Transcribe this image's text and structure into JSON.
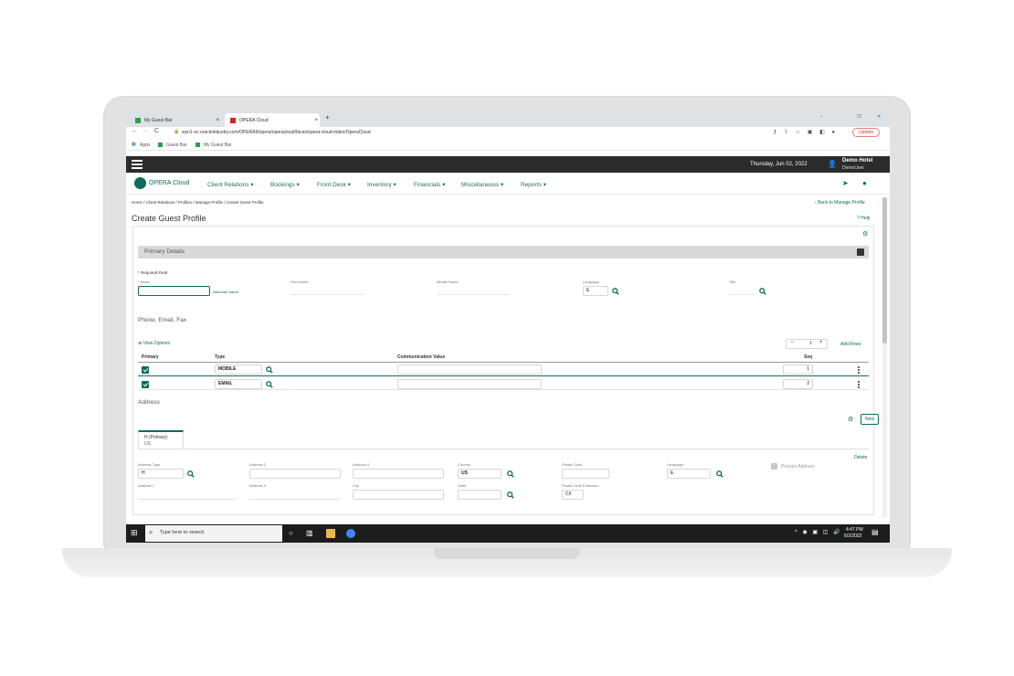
{
  "browser": {
    "tabs": [
      {
        "label": "My Guest Bar"
      },
      {
        "label": "OPERA Cloud"
      }
    ],
    "new_tab": "+",
    "url": "wyn1-oc.oracleindustry.com/OPERA9/opera/operacloud/faces/opera-cloud-index/OperaCloud",
    "bookmarks": [
      "Apps",
      "Guest Bar",
      "My Guest Bar"
    ],
    "update_label": "Update",
    "window_controls": [
      "–",
      "❐",
      "✕"
    ]
  },
  "header": {
    "date": "Thursday, Jun 02, 2022",
    "hotel": "Demo Hotel",
    "user": "DemoUser"
  },
  "nav": {
    "brand": "OPERA Cloud",
    "items": [
      "Client Relations",
      "Bookings",
      "Front Desk",
      "Inventory",
      "Financials",
      "Miscellaneous",
      "Reports"
    ]
  },
  "breadcrumb": "Home / Client Relations / Profiles / Manage Profile / Create Guest Profile",
  "back_link": "Back to Manage Profile",
  "page_title": "Create Guest Profile",
  "help": "Help",
  "primary": {
    "section_title": "Primary Details",
    "required": "* Required Field",
    "name_label": "* Name",
    "alt_name": "Alternate Name",
    "first_name": "First Name",
    "middle_name": "Middle Name",
    "language_label": "Language",
    "language_value": "E",
    "title_label": "Title"
  },
  "comm": {
    "heading": "Phone, Email, Fax",
    "view_options": "View Options",
    "rows_count": "1",
    "add_rows": "Add Rows",
    "cols": [
      "Primary",
      "Type",
      "Communication Value",
      "Seq"
    ],
    "rows": [
      {
        "type": "MOBILE",
        "value": "",
        "seq": "1"
      },
      {
        "type": "EMAIL",
        "value": "",
        "seq": "2"
      }
    ]
  },
  "address": {
    "heading": "Address",
    "new_label": "New",
    "tab_title": "H (Primary)",
    "tab_sub": "US",
    "delete": "Delete",
    "address_type_label": "Address Type",
    "address_type_value": "H",
    "address2": "Address 2",
    "address4": "Address 4",
    "country_label": "Country",
    "country_value": "US",
    "postal_label": "Postal Code",
    "language_label": "Language",
    "language_value": "E",
    "primary_address": "Primary Address",
    "address1": "Address 1",
    "address3": "Address 3",
    "city": "City",
    "state": "State",
    "postal_ext_label": "Postal Code Extension",
    "postal_ext_value": "C/I"
  },
  "taskbar": {
    "search_placeholder": "Type here to search",
    "time": "4:47 PM",
    "date": "6/2/2022"
  },
  "colors": {
    "accent": "#0f6b5c",
    "header": "#2b2b2b",
    "nav_text": "#1f6f64"
  }
}
